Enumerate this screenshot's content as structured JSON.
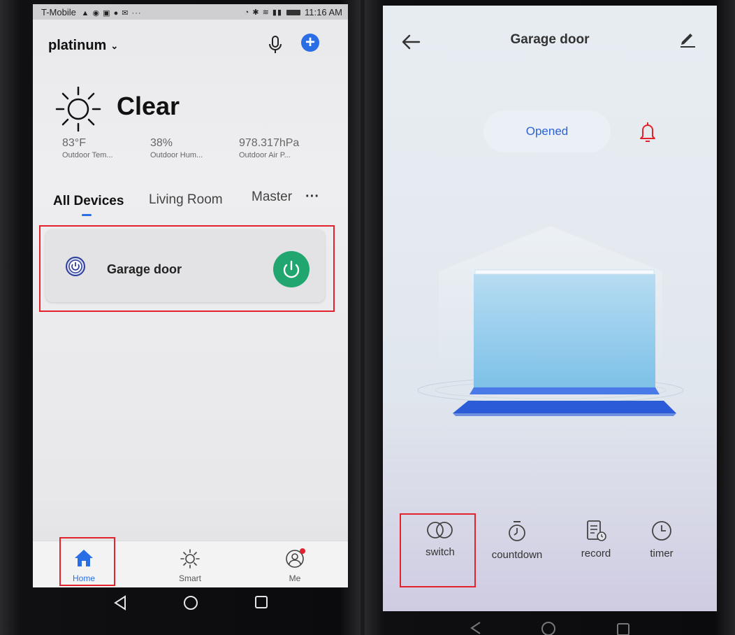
{
  "left_screen": {
    "status_bar": {
      "carrier": "T-Mobile",
      "time": "11:16 AM"
    },
    "header": {
      "home_name": "platinum",
      "mic_icon": "mic-icon",
      "add_icon": "plus-icon"
    },
    "weather": {
      "condition": "Clear",
      "stats": [
        {
          "value": "83°F",
          "label": "Outdoor Tem..."
        },
        {
          "value": "38%",
          "label": "Outdoor Hum..."
        },
        {
          "value": "978.317hPa",
          "label": "Outdoor Air P..."
        }
      ]
    },
    "tabs": [
      {
        "label": "All Devices",
        "active": true
      },
      {
        "label": "Living Room",
        "active": false
      },
      {
        "label": "Master",
        "active": false
      }
    ],
    "tabs_more": "···",
    "devices": [
      {
        "name": "Garage door",
        "power_on": true
      }
    ],
    "bottom_nav": [
      {
        "label": "Home",
        "icon": "home-icon",
        "active": true
      },
      {
        "label": "Smart",
        "icon": "sun-icon",
        "active": false
      },
      {
        "label": "Me",
        "icon": "profile-icon",
        "active": false,
        "badge": true
      }
    ]
  },
  "right_screen": {
    "header": {
      "title": "Garage door",
      "back_icon": "back-arrow-icon",
      "edit_icon": "pencil-icon"
    },
    "door_status": "Opened",
    "alert_icon": "bell-icon",
    "actions": [
      {
        "label": "switch",
        "icon": "switch-icon"
      },
      {
        "label": "countdown",
        "icon": "stopwatch-icon"
      },
      {
        "label": "record",
        "icon": "record-icon"
      },
      {
        "label": "timer",
        "icon": "clock-icon"
      }
    ]
  },
  "colors": {
    "accent": "#2a6ee6",
    "power_on": "#22a670",
    "status_text": "#2b62d6",
    "alert": "#e2222c"
  }
}
